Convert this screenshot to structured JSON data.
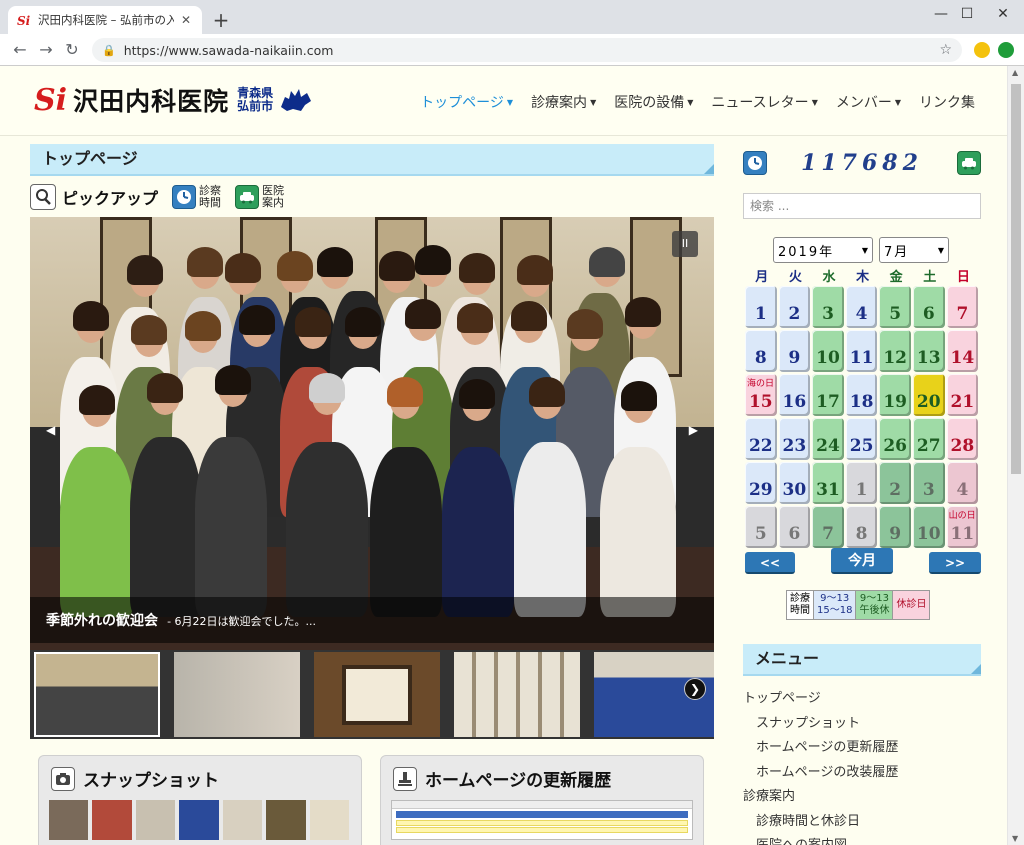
{
  "browser": {
    "tab_title": "沢田内科医院 – 弘前市の入院設備",
    "url": "https://www.sawada-naikaiin.com",
    "minimize": "—",
    "maximize": "☐",
    "close": "✕"
  },
  "header": {
    "logo_mark": "Si",
    "logo_name": "沢田内科医院",
    "region_line1": "青森県",
    "region_line2": "弘前市"
  },
  "nav": {
    "items": [
      {
        "label": "トップページ",
        "caret": "▼"
      },
      {
        "label": "診療案内",
        "caret": "▼"
      },
      {
        "label": "医院の設備",
        "caret": "▼"
      },
      {
        "label": "ニュースレター",
        "caret": "▼"
      },
      {
        "label": "メンバー",
        "caret": "▼"
      },
      {
        "label": "リンク集",
        "caret": ""
      }
    ]
  },
  "main": {
    "section_title": "トップページ",
    "pickup_title": "ピックアップ",
    "link_hours_1": "診察",
    "link_hours_2": "時間",
    "link_guide_1": "医院",
    "link_guide_2": "案内",
    "slide_caption_title": "季節外れの歓迎会",
    "slide_caption_text": "- 6月22日は歓迎会でした。...",
    "pause_label": "II",
    "prev_arrow": "◀",
    "next_arrow": "▶",
    "thumb_next": "❯"
  },
  "cards": [
    {
      "title": "スナップショット"
    },
    {
      "title": "ホームページの更新履歴"
    }
  ],
  "sidebar": {
    "counter": "117682",
    "search_placeholder": "検索 ...",
    "year_select": "2019年",
    "month_select": "7月",
    "weekdays": [
      "月",
      "火",
      "水",
      "木",
      "金",
      "土",
      "日"
    ],
    "weekday_colors": [
      "#1c2f86",
      "#1c2f86",
      "#1d6b2b",
      "#1c2f86",
      "#1d6b2b",
      "#1d6b2b",
      "#c4002a"
    ],
    "calendar": [
      {
        "d": "1",
        "t": "wk"
      },
      {
        "d": "2",
        "t": "wk"
      },
      {
        "d": "3",
        "t": "am"
      },
      {
        "d": "4",
        "t": "wk"
      },
      {
        "d": "5",
        "t": "am"
      },
      {
        "d": "6",
        "t": "am"
      },
      {
        "d": "7",
        "t": "hol"
      },
      {
        "d": "8",
        "t": "wk"
      },
      {
        "d": "9",
        "t": "wk"
      },
      {
        "d": "10",
        "t": "am"
      },
      {
        "d": "11",
        "t": "wk"
      },
      {
        "d": "12",
        "t": "am"
      },
      {
        "d": "13",
        "t": "am"
      },
      {
        "d": "14",
        "t": "hol"
      },
      {
        "d": "15",
        "t": "hol",
        "note": "海の日"
      },
      {
        "d": "16",
        "t": "wk"
      },
      {
        "d": "17",
        "t": "am"
      },
      {
        "d": "18",
        "t": "wk"
      },
      {
        "d": "19",
        "t": "am"
      },
      {
        "d": "20",
        "t": "today"
      },
      {
        "d": "21",
        "t": "hol"
      },
      {
        "d": "22",
        "t": "wk"
      },
      {
        "d": "23",
        "t": "wk"
      },
      {
        "d": "24",
        "t": "am"
      },
      {
        "d": "25",
        "t": "wk"
      },
      {
        "d": "26",
        "t": "am"
      },
      {
        "d": "27",
        "t": "am"
      },
      {
        "d": "28",
        "t": "hol"
      },
      {
        "d": "29",
        "t": "wk"
      },
      {
        "d": "30",
        "t": "wk"
      },
      {
        "d": "31",
        "t": "am"
      },
      {
        "d": "1",
        "t": "out"
      },
      {
        "d": "2",
        "t": "outam"
      },
      {
        "d": "3",
        "t": "outam"
      },
      {
        "d": "4",
        "t": "outhol"
      },
      {
        "d": "5",
        "t": "out"
      },
      {
        "d": "6",
        "t": "out"
      },
      {
        "d": "7",
        "t": "outam"
      },
      {
        "d": "8",
        "t": "out"
      },
      {
        "d": "9",
        "t": "outam"
      },
      {
        "d": "10",
        "t": "outam"
      },
      {
        "d": "11",
        "t": "outhol",
        "note": "山の日"
      }
    ],
    "prev_btn": "<<",
    "today_btn": "今月",
    "next_btn": ">>",
    "legend": {
      "label_1": "診療",
      "label_2": "時間",
      "weekday_1": "9～13",
      "weekday_2": "15～18",
      "half_1": "9～13",
      "half_2": "午後休",
      "holiday": "休診日"
    },
    "menu_title": "メニュー",
    "menu": [
      {
        "label": "トップページ",
        "sub": false
      },
      {
        "label": "スナップショット",
        "sub": true
      },
      {
        "label": "ホームページの更新履歴",
        "sub": true
      },
      {
        "label": "ホームページの改装履歴",
        "sub": true
      },
      {
        "label": "診療案内",
        "sub": false
      },
      {
        "label": "診療時間と休診日",
        "sub": true
      },
      {
        "label": "医院への案内図",
        "sub": true
      }
    ]
  }
}
